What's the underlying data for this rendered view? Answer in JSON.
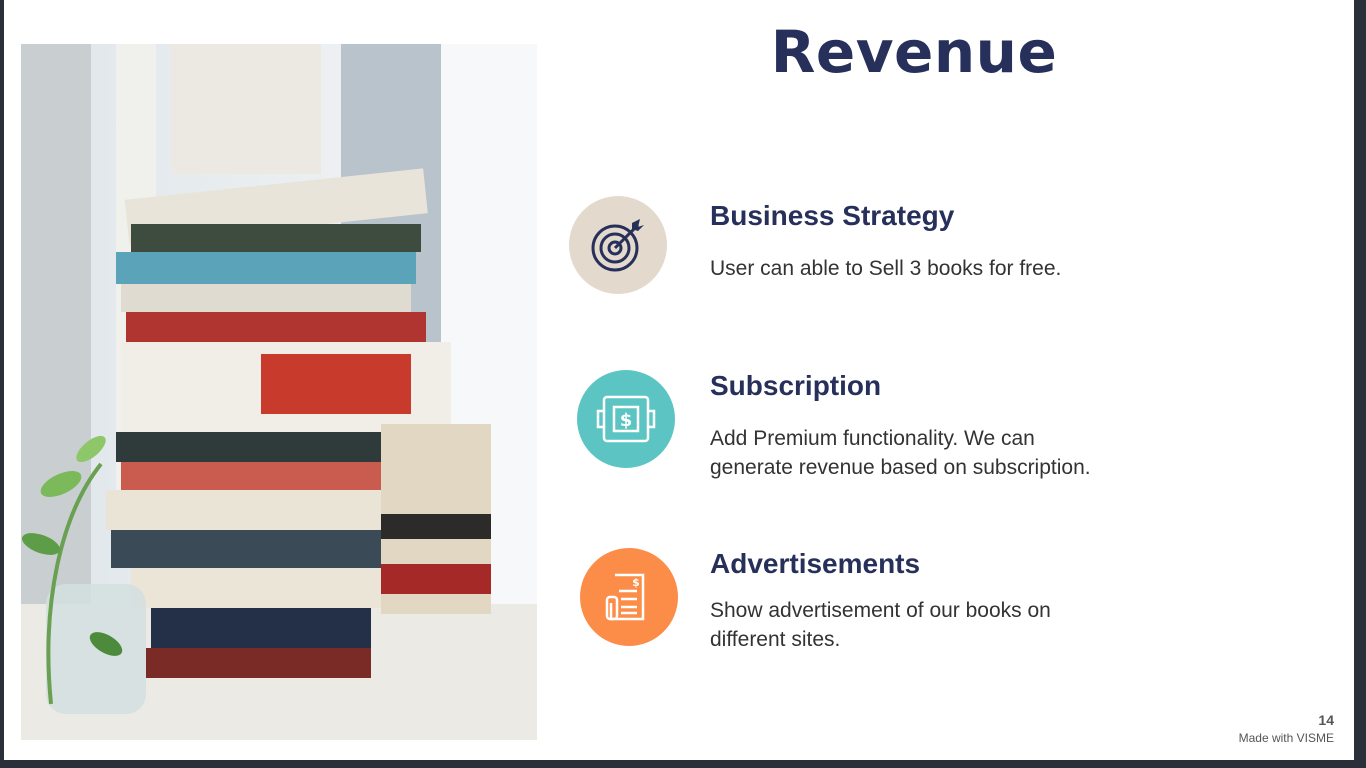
{
  "title": "Revenue",
  "items": [
    {
      "heading": "Business Strategy",
      "description": " User can able to  Sell   3 books for free.",
      "icon": "target-icon",
      "color": "#e3d9cc"
    },
    {
      "heading": "Subscription",
      "description": " Add Premium functionality. We can\ngenerate revenue based on subscription.",
      "icon": "dollar-cycle-icon",
      "color": "#5cc5c4"
    },
    {
      "heading": "Advertisements",
      "description": " Show advertisement of our books on\ndifferent sites.",
      "icon": "invoice-icon",
      "color": "#fb8d49"
    }
  ],
  "page_number": "14",
  "credit": "Made with VISME",
  "colors": {
    "heading": "#27305a",
    "background": "#ffffff"
  }
}
